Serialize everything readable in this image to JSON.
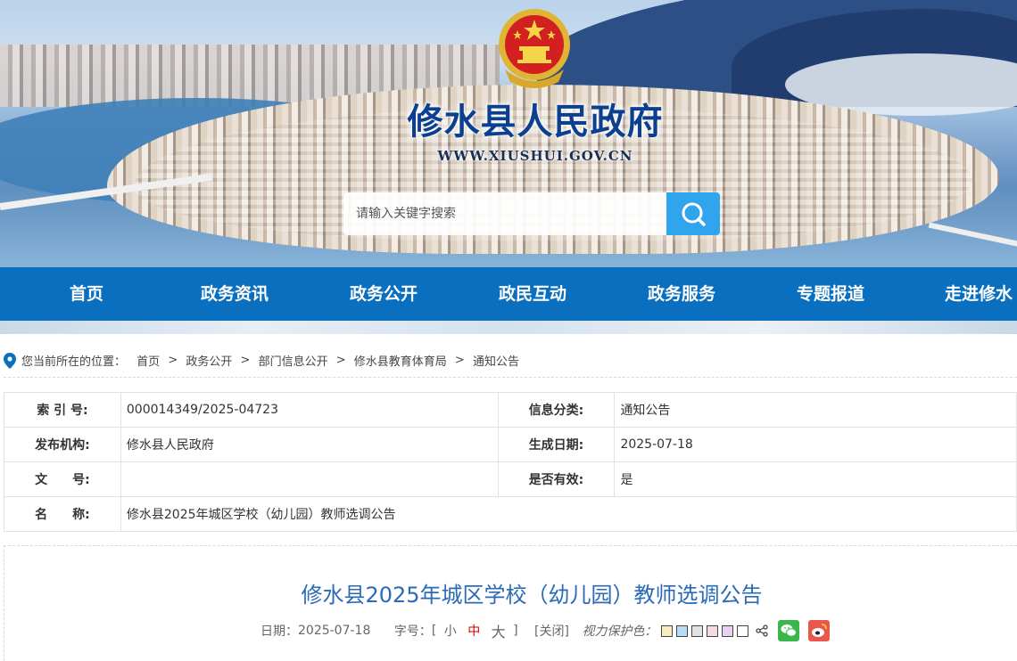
{
  "header": {
    "site_title": "修水县人民政府",
    "site_url": "WWW.XIUSHUI.GOV.CN",
    "search_placeholder": "请输入关键字搜索"
  },
  "nav": [
    "首页",
    "政务资讯",
    "政务公开",
    "政民互动",
    "政务服务",
    "专题报道",
    "走进修水"
  ],
  "breadcrumb": {
    "prefix": "您当前所在的位置：",
    "items": [
      "首页",
      "政务公开",
      "部门信息公开",
      "修水县教育体育局",
      "通知公告"
    ],
    "separator": ">"
  },
  "info": {
    "index_label": "索 引 号:",
    "index_value": "000014349/2025-04723",
    "category_label": "信息分类:",
    "category_value": "通知公告",
    "publisher_label": "发布机构:",
    "publisher_value": "修水县人民政府",
    "date_label": "生成日期:",
    "date_value": "2025-07-18",
    "docno_label": "文　　号:",
    "docno_value": "",
    "valid_label": "是否有效:",
    "valid_value": "是",
    "name_label": "名　　称:",
    "name_value": "修水县2025年城区学校（幼儿园）教师选调公告"
  },
  "article": {
    "title": "修水县2025年城区学校（幼儿园）教师选调公告",
    "date_label": "日期：",
    "date": "2025-07-18",
    "fontsize_label": "字号：",
    "bracket_open": "[",
    "bracket_close": "]",
    "size_small": "小",
    "size_medium": "中",
    "size_large": "大",
    "close_label": "[关闭]",
    "eye_label": "视力保护色：",
    "swatch_colors": [
      "#f9ecc0",
      "#b8dcf6",
      "#e2e2e2",
      "#f7d9e3",
      "#e6d2f0",
      "#ffffff"
    ]
  },
  "colors": {
    "nav_bg": "#0a6fbe",
    "search_button": "#31a4ee",
    "title_blue": "#2a6ab6",
    "active_size": "#d20000"
  },
  "icons": [
    "emblem-icon",
    "search-icon",
    "location-pin-icon",
    "share-icon",
    "wechat-icon",
    "weibo-icon"
  ]
}
